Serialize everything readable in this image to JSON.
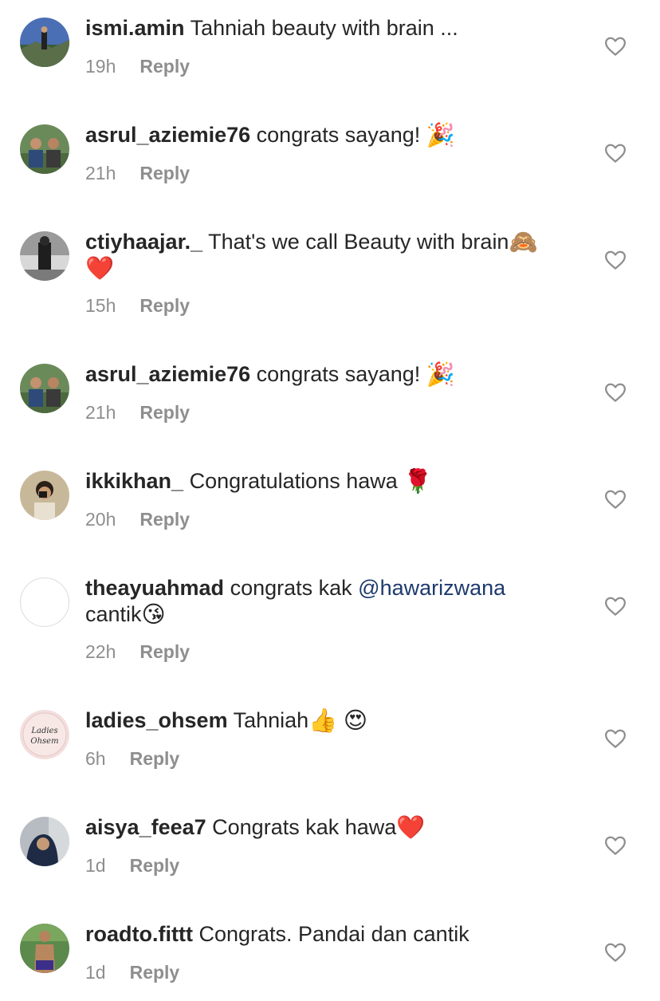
{
  "reply_label": "Reply",
  "comments": [
    {
      "username": "ismi.amin",
      "text": "Tahniah beauty with brain ...",
      "time": "19h"
    },
    {
      "username": "asrul_aziemie76",
      "text": "congrats sayang!",
      "emoji": "🎉",
      "time": "21h"
    },
    {
      "username": "ctiyhaajar._",
      "text": "That's we call Beauty with brain",
      "emoji": "🙈",
      "line2_emoji": "❤️",
      "time": "15h"
    },
    {
      "username": "asrul_aziemie76",
      "text": "congrats sayang!",
      "emoji": "🎉",
      "time": "21h"
    },
    {
      "username": "ikkikhan_",
      "text": "Congratulations hawa",
      "emoji": "🌹",
      "time": "20h"
    },
    {
      "username": "theayuahmad",
      "text": "congrats kak",
      "mention": "@hawarizwana",
      "line2_text": "cantik",
      "line2_emoji": "😘",
      "time": "22h"
    },
    {
      "username": "ladies_ohsem",
      "text": "Tahniah",
      "emoji": "👍",
      "emoji2": "😍",
      "time": "6h",
      "avatar_text": "Ladies Ohsem"
    },
    {
      "username": "aisya_feea7",
      "text": "Congrats kak hawa",
      "emoji": "❤️",
      "time": "1d"
    },
    {
      "username": "roadto.fittt",
      "text": "Congrats. Pandai dan cantik",
      "time": "1d"
    }
  ],
  "colors": {
    "username": "#262626",
    "text": "#262626",
    "meta": "#8e8e8e",
    "mention": "#1e3a6e",
    "heart_stroke": "#8e8e8e"
  }
}
